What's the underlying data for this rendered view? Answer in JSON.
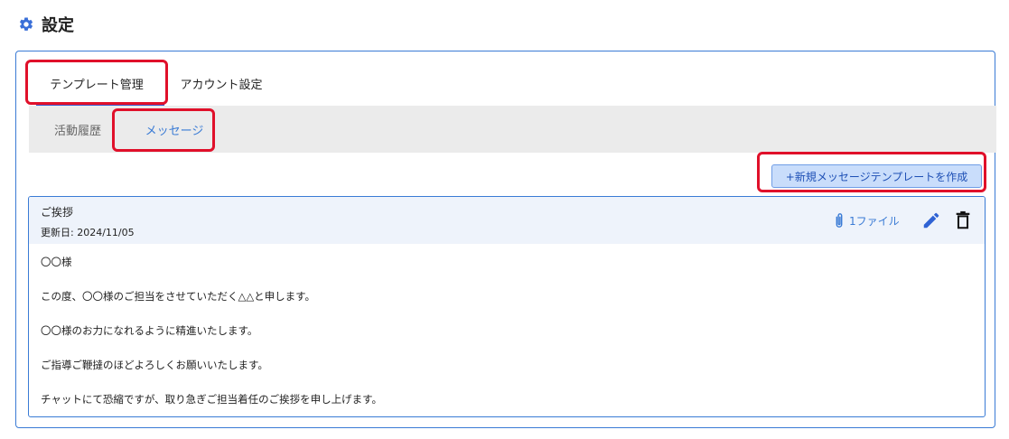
{
  "header": {
    "title": "設定",
    "icon": "gear-icon",
    "icon_color": "#3a6fd8"
  },
  "tabs": [
    {
      "label": "テンプレート管理",
      "active": true
    },
    {
      "label": "アカウント設定",
      "active": false
    }
  ],
  "subtabs": [
    {
      "label": "活動履歴",
      "active": false
    },
    {
      "label": "メッセージ",
      "active": true
    }
  ],
  "new_template_button": {
    "label": "+新規メッセージテンプレートを作成"
  },
  "template": {
    "title": "ご挨拶",
    "updated": "更新日: 2024/11/05",
    "attachments_label": "1ファイル",
    "body": [
      "〇〇様",
      "この度、〇〇様のご担当をさせていただく△△と申します。",
      "〇〇様のお力になれるように精進いたします。",
      "ご指導ご鞭撻のほどよろしくお願いいたします。",
      "チャットにて恐縮ですが、取り急ぎご担当着任のご挨拶を申し上げます。"
    ]
  },
  "colors": {
    "accent": "#3a7bd5",
    "highlight": "#e0102a",
    "button_bg": "#c9ddfb"
  }
}
